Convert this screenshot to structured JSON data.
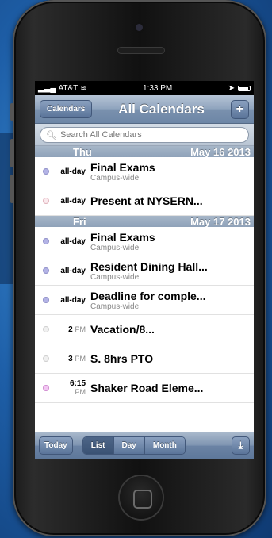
{
  "status": {
    "carrier": "AT&T",
    "time": "1:33 PM"
  },
  "nav": {
    "left_button": "Calendars",
    "title": "All Calendars",
    "add_label": "+"
  },
  "search": {
    "placeholder": "Search All Calendars"
  },
  "sections": [
    {
      "day": "Thu",
      "date": "May 16 2013",
      "events": [
        {
          "time": "all-day",
          "ampm": "",
          "title": "Final Exams",
          "subtitle": "Campus-wide",
          "dot": "#b3b3e6"
        },
        {
          "time": "all-day",
          "ampm": "",
          "title": "Present at NYSERN...",
          "subtitle": "",
          "dot": "#f3d3d8"
        }
      ]
    },
    {
      "day": "Fri",
      "date": "May 17 2013",
      "events": [
        {
          "time": "all-day",
          "ampm": "",
          "title": "Final Exams",
          "subtitle": "Campus-wide",
          "dot": "#b3b3e6"
        },
        {
          "time": "all-day",
          "ampm": "",
          "title": "Resident Dining Hall...",
          "subtitle": "Campus-wide",
          "dot": "#b3b3e6"
        },
        {
          "time": "all-day",
          "ampm": "",
          "title": "Deadline for comple...",
          "subtitle": "Campus-wide",
          "dot": "#b3b3e6"
        },
        {
          "time": "2",
          "ampm": "PM",
          "title": "Vacation/8...",
          "subtitle": "",
          "dot": "#e6e6e6"
        },
        {
          "time": "3",
          "ampm": "PM",
          "title": "S. 8hrs PTO",
          "subtitle": "",
          "dot": "#e6e6e6"
        },
        {
          "time": "6:15",
          "ampm": "PM",
          "title": "Shaker Road Eleme...",
          "subtitle": "",
          "dot": "#e8b3e8"
        }
      ]
    }
  ],
  "toolbar": {
    "today": "Today",
    "list": "List",
    "day": "Day",
    "month": "Month",
    "download_icon": "download-icon"
  }
}
